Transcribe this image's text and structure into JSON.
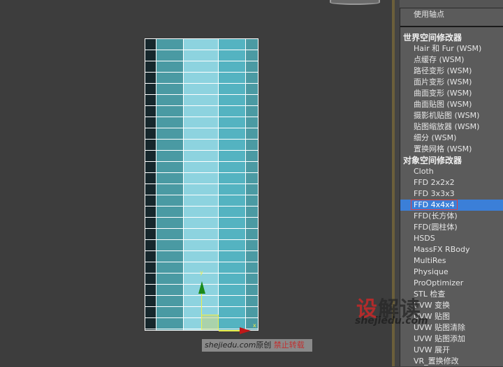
{
  "colors": {
    "viewport_bg": "#3d3d3d",
    "panel_bg": "#5b5b5b",
    "selection": "#3b7fd8",
    "mesh_columns": [
      "#16272c",
      "#4a9aa3",
      "#8dd3df",
      "#54b3c1",
      "#4b9aa3"
    ]
  },
  "viewport": {
    "axis_labels": {
      "y": "y",
      "x": "x"
    },
    "caption": {
      "site": "shejiedu.com",
      "original": "原创",
      "warning": "禁止转载"
    }
  },
  "watermark": {
    "logo": "设解读",
    "url": "shejiedu.com"
  },
  "dropdown": {
    "top_item": "使用轴点",
    "groups": [
      {
        "header": "世界空间修改器",
        "items": [
          "Hair 和 Fur (WSM)",
          "点缓存 (WSM)",
          "路径变形 (WSM)",
          "面片变形 (WSM)",
          "曲面变形 (WSM)",
          "曲面贴图 (WSM)",
          "摄影机贴图 (WSM)",
          "贴图缩放器 (WSM)",
          "细分 (WSM)",
          "置换网格 (WSM)"
        ]
      },
      {
        "header": "对象空间修改器",
        "items": [
          "Cloth",
          "FFD 2x2x2",
          "FFD 3x3x3",
          "FFD 4x4x4",
          "FFD(长方体)",
          "FFD(圆柱体)",
          "HSDS",
          "MassFX RBody",
          "MultiRes",
          "Physique",
          "ProOptimizer",
          "STL 检查",
          "UVW 变换",
          "UVW 贴图",
          "UVW 贴图清除",
          "UVW 贴图添加",
          "UVW 展开",
          "VR_置换修改"
        ]
      }
    ],
    "selected": "FFD 4x4x4"
  }
}
